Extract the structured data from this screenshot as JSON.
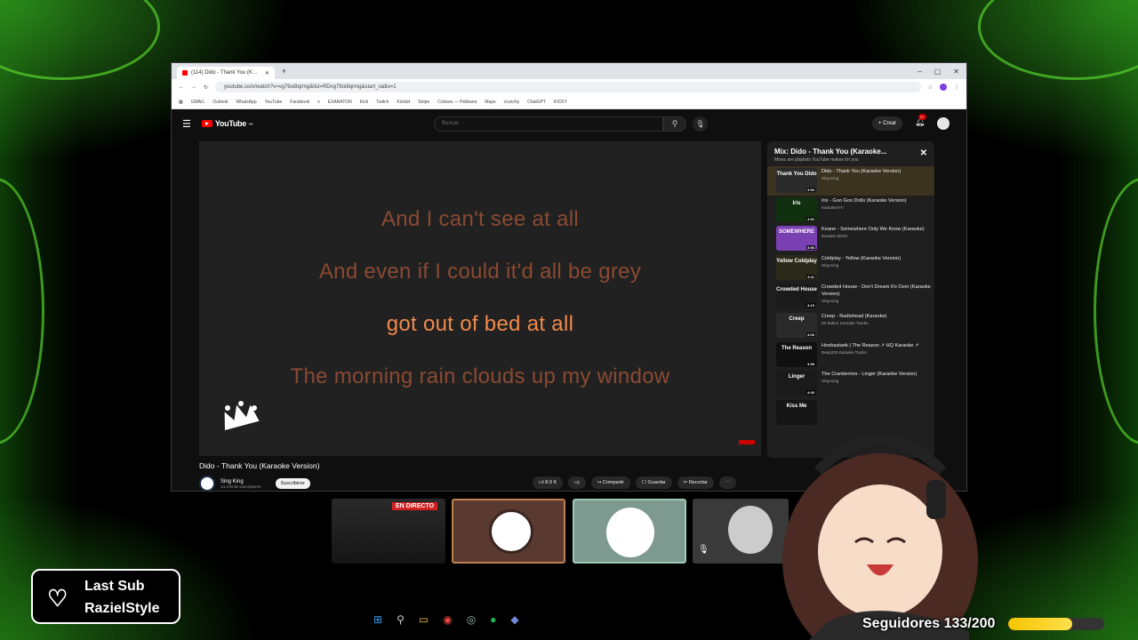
{
  "browser": {
    "tab_title": "(114) Dido - Thank You (K…",
    "url": "youtube.com/watch?v=vg79oi8qrmg&list=RDvg79oi8qrmg&start_radio=1",
    "bookmarks": [
      "GMAIL",
      "Outlook",
      "WhatsApp",
      "YouTube",
      "Facebook",
      "x",
      "EXARATON",
      "Kick",
      "Twitch",
      "Kicklet",
      "Stripe",
      "Colores — Pelikano",
      "Maps",
      "crunchy",
      "ChatGPT",
      "KICKY"
    ]
  },
  "youtube": {
    "logo": "YouTube",
    "logo_region": "PE",
    "search_placeholder": "Buscar",
    "create_label": "Crear",
    "notif_badge": "9+",
    "lyrics": [
      "And I can't see at all",
      "And even if I could it'd all be grey",
      "got out of bed at all",
      "The morning rain clouds up my window"
    ],
    "video_title": "Dido - Thank You (Karaoke Version)",
    "channel": "Sing King",
    "subscribers": "14.3 M de suscriptores",
    "subscribe_label": "Suscribirse",
    "actions": {
      "likes": "8.9 K",
      "share": "Compartir",
      "save": "Guardar",
      "clip": "Recortar",
      "more": "⋯"
    }
  },
  "playlist": {
    "title": "Mix: Dido - Thank You (Karaoke...",
    "subtitle": "Mixes are playlists YouTube makes for you",
    "items": [
      {
        "thumb": "Thank You Dido",
        "duration": "3:53",
        "title": "Dido - Thank You (Karaoke Version)",
        "channel": "Sing King",
        "color": "#2a2a2a"
      },
      {
        "thumb": "Iris",
        "duration": "4:52",
        "title": "Iris - Goo Goo Dolls (Karaoke Version)",
        "channel": "KaraokeyTV",
        "color": "#103010"
      },
      {
        "thumb": "SOMEWHERE",
        "duration": "3:56",
        "title": "Keane - Somewhere Only We Know (Karaoke)",
        "channel": "karaoke SESH",
        "color": "#7a3fb0"
      },
      {
        "thumb": "Yellow Coldplay",
        "duration": "4:41",
        "title": "Coldplay - Yellow (Karaoke Version)",
        "channel": "Sing King",
        "color": "#2a2a1a"
      },
      {
        "thumb": "Crowded House",
        "duration": "4:15",
        "title": "Crowded House - Don't Dream It's Over (Karaoke Version)",
        "channel": "Sing King",
        "color": "#1a1a1a"
      },
      {
        "thumb": "Creep",
        "duration": "4:06",
        "title": "Creep - Radiohead (Karaoke)",
        "channel": "Mr Baltrur Karaoke Tracks",
        "color": "#2a2a2a"
      },
      {
        "thumb": "The Reason",
        "duration": "3:58",
        "title": "Hoobastank | The Reason ↗ HQ Karaoke ↗",
        "channel": "Deep333 Karaoke Tracks",
        "color": "#101010"
      },
      {
        "thumb": "Linger",
        "duration": "4:39",
        "title": "The Cranberries - Linger (Karaoke Version)",
        "channel": "Sing King",
        "color": "#1a1a1a"
      },
      {
        "thumb": "Kiss Me",
        "duration": "",
        "title": "",
        "channel": "",
        "color": "#151515"
      }
    ]
  },
  "overlay": {
    "live_badge": "EN DIRECTO",
    "last_sub_title": "Last Sub",
    "last_sub_name": "RazielStyle",
    "followers_label": "Seguidores 133/200",
    "followers_progress": 0.665
  }
}
